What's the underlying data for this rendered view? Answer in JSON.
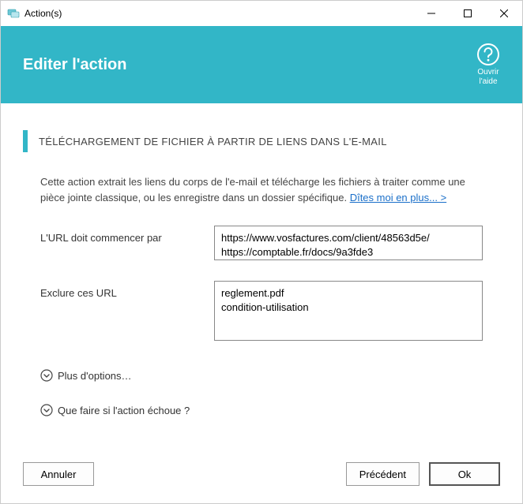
{
  "window": {
    "title": "Action(s)"
  },
  "header": {
    "title": "Editer l'action",
    "help_line1": "Ouvrir",
    "help_line2": "l'aide"
  },
  "section": {
    "heading": "TÉLÉCHARGEMENT DE FICHIER À PARTIR DE LIENS DANS L'E-MAIL"
  },
  "desc": {
    "text": "Cette action extrait les liens du corps de l'e-mail et télécharge les fichiers à traiter comme une pièce jointe classique, ou les enregistre dans un dossier spécifique. ",
    "link": "Dîtes moi en plus... >"
  },
  "form": {
    "url_label": "L'URL doit commencer par",
    "url_value": "https://www.vosfactures.com/client/48563d5e/\nhttps://comptable.fr/docs/9a3fde3",
    "exclude_label": "Exclure ces URL",
    "exclude_value": "reglement.pdf\ncondition-utilisation"
  },
  "expanders": {
    "more_options": "Plus d'options…",
    "on_fail": "Que faire si l'action échoue ?"
  },
  "buttons": {
    "cancel": "Annuler",
    "previous": "Précédent",
    "ok": "Ok"
  },
  "colors": {
    "accent": "#32b6c7"
  }
}
